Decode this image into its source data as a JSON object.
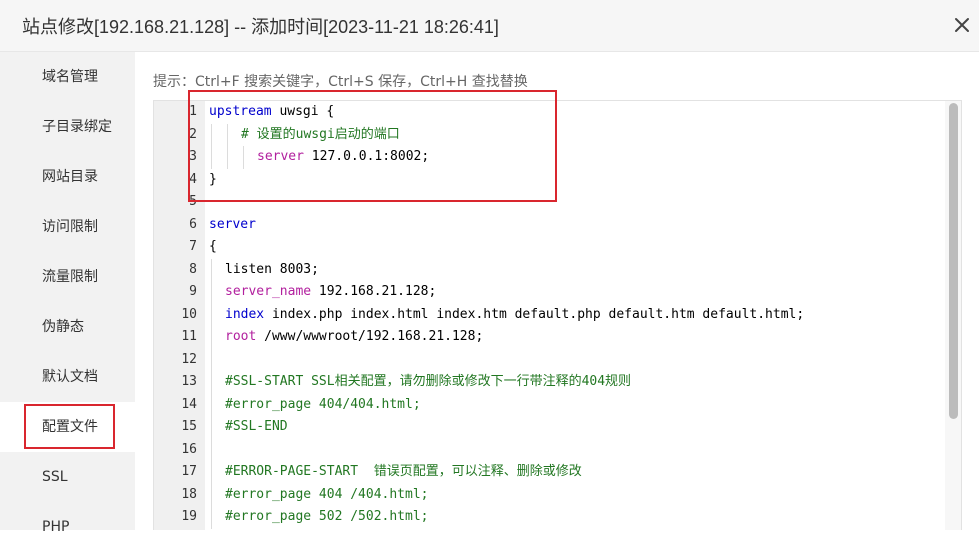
{
  "dialog": {
    "title": "站点修改[192.168.21.128] -- 添加时间[2023-11-21 18:26:41]",
    "close_icon": "close-icon"
  },
  "sidebar": {
    "items": [
      {
        "label": "域名管理"
      },
      {
        "label": "子目录绑定"
      },
      {
        "label": "网站目录"
      },
      {
        "label": "访问限制"
      },
      {
        "label": "流量限制"
      },
      {
        "label": "伪静态"
      },
      {
        "label": "默认文档"
      },
      {
        "label": "配置文件",
        "active": true
      },
      {
        "label": "SSL"
      },
      {
        "label": "PHP"
      }
    ]
  },
  "editor": {
    "hint": "提示：Ctrl+F 搜索关键字，Ctrl+S 保存，Ctrl+H 查找替换",
    "lines": [
      {
        "n": "1",
        "indent": 0,
        "parts": [
          {
            "t": "upstream",
            "c": "kw"
          },
          {
            "t": " uwsgi {",
            "c": ""
          }
        ]
      },
      {
        "n": "2",
        "indent": 2,
        "parts": [
          {
            "t": "# 设置的uwsgi启动的端口",
            "c": "cm"
          }
        ]
      },
      {
        "n": "3",
        "indent": 3,
        "parts": [
          {
            "t": "server",
            "c": "prop"
          },
          {
            "t": " 127.0.0.1:8002;",
            "c": ""
          }
        ]
      },
      {
        "n": "4",
        "indent": 0,
        "parts": [
          {
            "t": "}",
            "c": ""
          }
        ]
      },
      {
        "n": "5",
        "indent": 0,
        "parts": []
      },
      {
        "n": "6",
        "indent": 0,
        "parts": [
          {
            "t": "server",
            "c": "kw"
          }
        ]
      },
      {
        "n": "7",
        "indent": 0,
        "parts": [
          {
            "t": "{",
            "c": ""
          }
        ]
      },
      {
        "n": "8",
        "indent": 1,
        "parts": [
          {
            "t": "listen",
            "c": ""
          },
          {
            "t": " 8003;",
            "c": ""
          }
        ]
      },
      {
        "n": "9",
        "indent": 1,
        "parts": [
          {
            "t": "server_name",
            "c": "prop"
          },
          {
            "t": " 192.168.21.128;",
            "c": ""
          }
        ]
      },
      {
        "n": "10",
        "indent": 1,
        "parts": [
          {
            "t": "index",
            "c": "kw"
          },
          {
            "t": " index.php index.html index.htm default.php default.htm default.html;",
            "c": ""
          }
        ]
      },
      {
        "n": "11",
        "indent": 1,
        "parts": [
          {
            "t": "root",
            "c": "prop"
          },
          {
            "t": " /www/wwwroot/192.168.21.128;",
            "c": ""
          }
        ]
      },
      {
        "n": "12",
        "indent": 1,
        "parts": []
      },
      {
        "n": "13",
        "indent": 1,
        "parts": [
          {
            "t": "#SSL-START SSL相关配置，请勿删除或修改下一行带注释的404规则",
            "c": "cm"
          }
        ]
      },
      {
        "n": "14",
        "indent": 1,
        "parts": [
          {
            "t": "#error_page 404/404.html;",
            "c": "cm"
          }
        ]
      },
      {
        "n": "15",
        "indent": 1,
        "parts": [
          {
            "t": "#SSL-END",
            "c": "cm"
          }
        ]
      },
      {
        "n": "16",
        "indent": 1,
        "parts": []
      },
      {
        "n": "17",
        "indent": 1,
        "parts": [
          {
            "t": "#ERROR-PAGE-START  错误页配置，可以注释、删除或修改",
            "c": "cm"
          }
        ]
      },
      {
        "n": "18",
        "indent": 1,
        "parts": [
          {
            "t": "#error_page 404 /404.html;",
            "c": "cm"
          }
        ]
      },
      {
        "n": "19",
        "indent": 1,
        "parts": [
          {
            "t": "#error_page 502 /502.html;",
            "c": "cm"
          }
        ]
      }
    ]
  },
  "colors": {
    "keyword": "#0000cd",
    "property": "#b2209e",
    "comment": "#227722",
    "highlight_border": "#d9262e"
  }
}
